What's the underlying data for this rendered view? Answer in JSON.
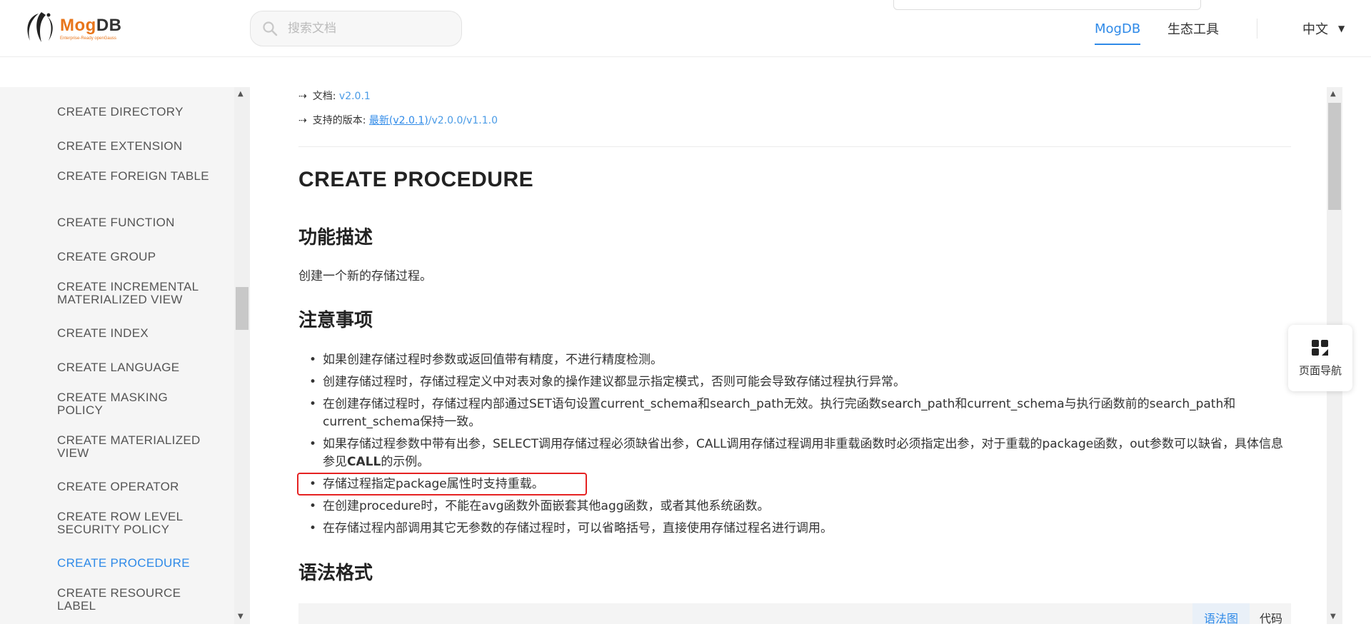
{
  "header": {
    "logo_name_part1": "Mog",
    "logo_name_part2": "DB",
    "logo_tagline": "Enterprise-Ready openGauss",
    "search_placeholder": "搜索文档",
    "nav": [
      {
        "label": "MogDB",
        "active": true
      },
      {
        "label": "生态工具",
        "active": false
      }
    ],
    "language": "中文"
  },
  "sidebar": {
    "items": [
      {
        "label": "CREATE DIRECTORY",
        "active": false
      },
      {
        "label": "CREATE EXTENSION",
        "active": false
      },
      {
        "label": "CREATE FOREIGN TABLE",
        "active": false
      },
      {
        "label": "CREATE FUNCTION",
        "active": false
      },
      {
        "label": "CREATE GROUP",
        "active": false
      },
      {
        "label": "CREATE INCREMENTAL MATERIALIZED VIEW",
        "active": false
      },
      {
        "label": "CREATE INDEX",
        "active": false
      },
      {
        "label": "CREATE LANGUAGE",
        "active": false
      },
      {
        "label": "CREATE MASKING POLICY",
        "active": false
      },
      {
        "label": "CREATE MATERIALIZED VIEW",
        "active": false
      },
      {
        "label": "CREATE OPERATOR",
        "active": false
      },
      {
        "label": "CREATE ROW LEVEL SECURITY POLICY",
        "active": false
      },
      {
        "label": "CREATE PROCEDURE",
        "active": true
      },
      {
        "label": "CREATE RESOURCE LABEL",
        "active": false
      }
    ]
  },
  "doc_meta": {
    "doc_label": "文档:",
    "doc_version": "v2.0.1",
    "supported_label": "支持的版本:",
    "latest_link": "最新(v2.0.1)",
    "other_versions": "/v2.0.0/v1.1.0"
  },
  "content": {
    "title": "CREATE PROCEDURE",
    "section1_heading": "功能描述",
    "section1_text": "创建一个新的存储过程。",
    "section2_heading": "注意事项",
    "notes": [
      "如果创建存储过程时参数或返回值带有精度，不进行精度检测。",
      "创建存储过程时，存储过程定义中对表对象的操作建议都显示指定模式，否则可能会导致存储过程执行异常。",
      "在创建存储过程时，存储过程内部通过SET语句设置current_schema和search_path无效。执行完函数search_path和current_schema与执行函数前的search_path和current_schema保持一致。",
      "如果存储过程参数中带有出参，SELECT调用存储过程必须缺省出参，CALL调用存储过程调用非重载函数时必须指定出参，对于重载的package函数，out参数可以缺省，具体信息参见CALL的示例。",
      "存储过程指定package属性时支持重载。",
      "在创建procedure时，不能在avg函数外面嵌套其他agg函数，或者其他系统函数。",
      "在存储过程内部调用其它无参数的存储过程时，可以省略括号，直接使用存储过程名进行调用。"
    ],
    "highlighted_note_index": 4,
    "section3_heading": "语法格式",
    "code_tabs": [
      {
        "label": "语法图",
        "active": true
      },
      {
        "label": "代码",
        "active": false
      }
    ]
  },
  "page_nav_label": "页面导航",
  "colors": {
    "accent": "#2f8ae8",
    "brand_orange": "#e8751a",
    "highlight_box": "#e52222"
  }
}
